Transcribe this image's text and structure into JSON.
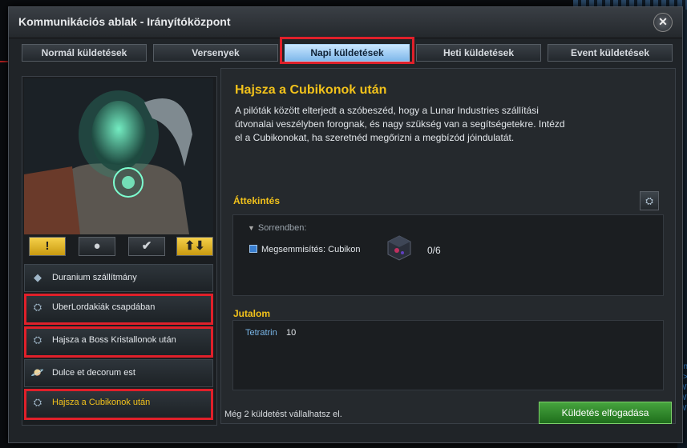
{
  "window": {
    "title": "Kommunikációs ablak - Irányítóközpont"
  },
  "tabs": [
    {
      "label": "Normál küldetések"
    },
    {
      "label": "Versenyek"
    },
    {
      "label": "Napi küldetések"
    },
    {
      "label": "Heti küldetések"
    },
    {
      "label": "Event küldetések"
    }
  ],
  "status_icons": [
    {
      "symbol": "!",
      "color": "#f2c21b"
    },
    {
      "symbol": "🔒",
      "color": "#d0d4d8"
    },
    {
      "symbol": "✔",
      "color": "#e8e8e8"
    },
    {
      "symbol": "⬆⬇",
      "color": "#f2c21b"
    }
  ],
  "missions": [
    {
      "label": "Duranium szállítmány",
      "icon": "diamond-icon"
    },
    {
      "label": "UberLordakiák csapdában",
      "icon": "ufo-icon"
    },
    {
      "label": "Hajsza a Boss Kristallonok után",
      "icon": "ufo-icon"
    },
    {
      "label": "Dulce et decorum est",
      "icon": "planet-icon"
    },
    {
      "label": "Hajsza a Cubikonok után",
      "icon": "ufo-icon"
    }
  ],
  "detail": {
    "title": "Hajsza a Cubikonok után",
    "description": "A pilóták között elterjedt a szóbeszéd, hogy a Lunar Industries szállítási útvonalai veszélyben forognak, és nagy szükség van a segítségetekre. Intézd el a Cubikonokat, ha szeretnéd megőrizni a megbízód jóindulatát.",
    "overview_heading": "Áttekintés",
    "order_label": "Sorrendben:",
    "objective": "Megsemmisítés: Cubikon",
    "progress": "0/6",
    "reward_heading": "Jutalom",
    "reward_name": "Tetratrin",
    "reward_value": "10",
    "footer_note": "Még 2 küldetést vállalhatsz el.",
    "accept_label": "Küldetés elfogadása"
  },
  "edge_text": [
    "enl",
    "l:>",
    "W",
    "W",
    "W"
  ],
  "colors": {
    "accent": "#f2c21b",
    "highlight": "#e0202a",
    "accept": "#2f8a2a"
  }
}
